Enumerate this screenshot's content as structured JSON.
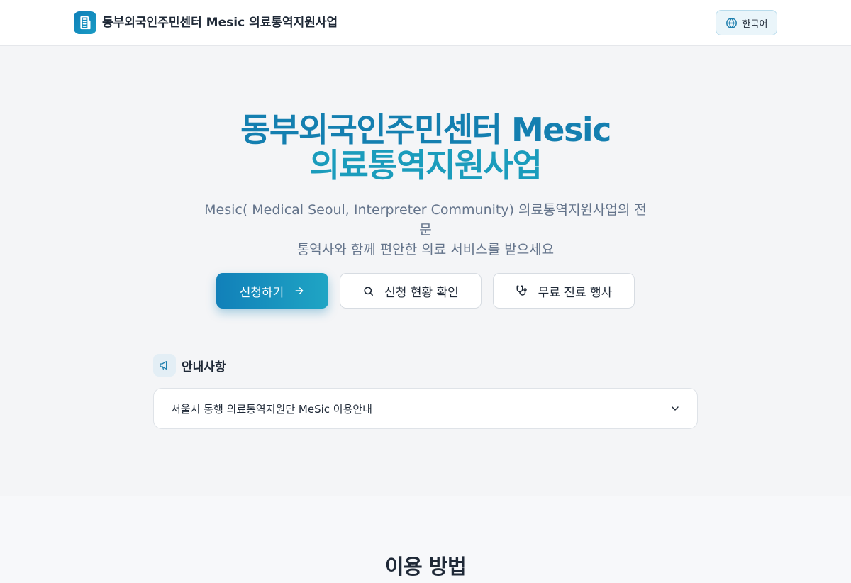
{
  "header": {
    "brand": "동부외국인주민센터 Mesic 의료통역지원사업",
    "logo_icon": "building-icon",
    "language_label": "한국어",
    "language_icon": "globe-icon"
  },
  "hero": {
    "title_line1": "동부외국인주민센터 Mesic",
    "title_line2": "의료통역지원사업",
    "subtitle_line1": "Mesic( Medical Seoul, Interpreter Community) 의료통역지원사업의 전문",
    "subtitle_line2": "통역사와 함께 편안한 의료 서비스를 받으세요",
    "buttons": {
      "apply": {
        "label": "신청하기",
        "icon": "arrow-right-icon"
      },
      "status": {
        "label": "신청 현황 확인",
        "icon": "search-icon"
      },
      "event": {
        "label": "무료 진료 행사",
        "icon": "stethoscope-icon"
      }
    }
  },
  "notice": {
    "title": "안내사항",
    "icon": "megaphone-icon",
    "items": [
      {
        "label": "서울시 동행 의료통역지원단 MeSic 이용안내",
        "icon": "chevron-down-icon"
      }
    ]
  },
  "how_to": {
    "title": "이용 방법"
  },
  "colors": {
    "brand_dark": "#147fb0",
    "brand_light": "#1b9cbc",
    "text": "#1f2937",
    "muted": "#64748b"
  }
}
